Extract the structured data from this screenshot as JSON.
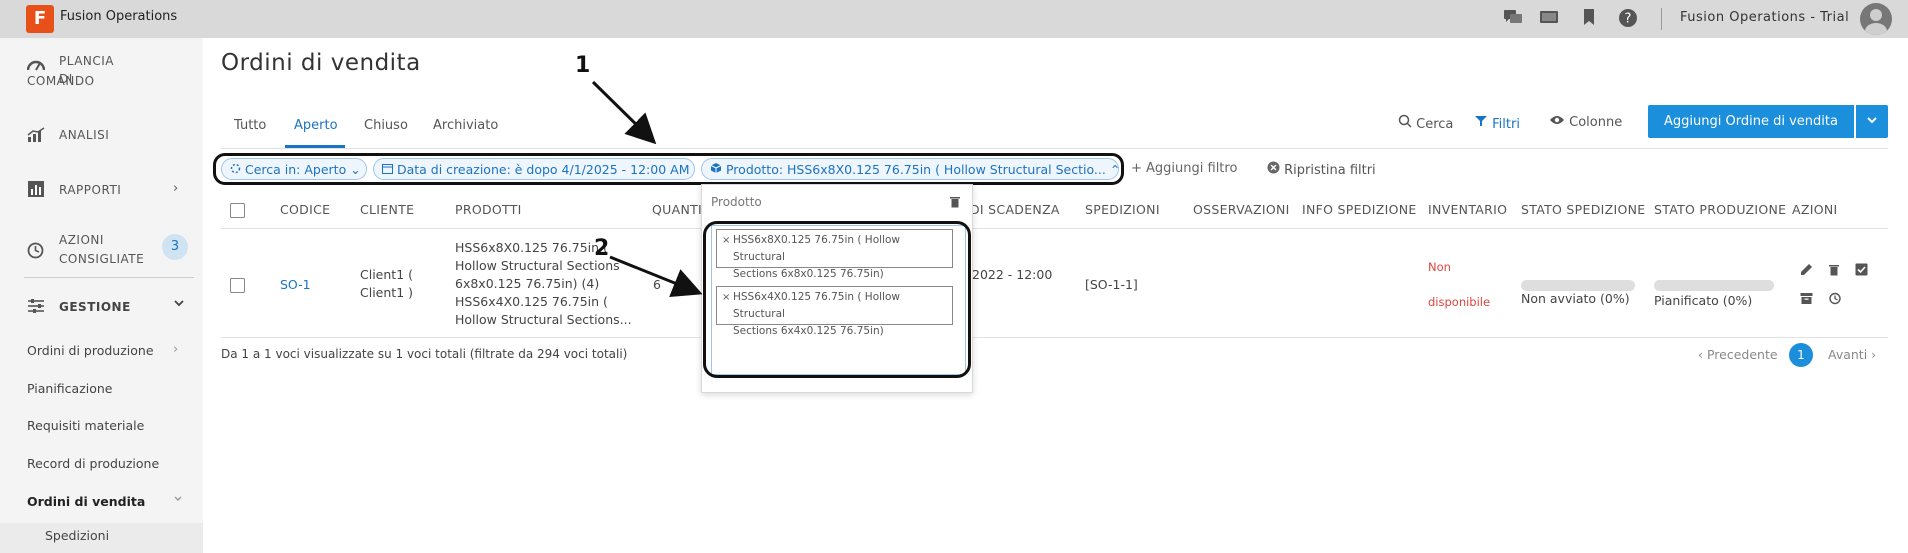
{
  "app": {
    "logo_letter": "F",
    "name": "Fusion Operations",
    "trial": "Fusion Operations - Trial"
  },
  "topbar_icons": [
    "chat-icon",
    "screen-icon",
    "bookmark-icon",
    "help-icon"
  ],
  "sidebar": {
    "dashboard_line1": "PLANCIA DI",
    "dashboard_line2": "COMANDO",
    "analysis": "ANALISI",
    "reports": "RAPPORTI",
    "suggested_line1": "AZIONI",
    "suggested_line2": "CONSIGLIATE",
    "suggested_count": "3",
    "management": "GESTIONE",
    "sub_items": [
      "Ordini di produzione",
      "Pianificazione",
      "Requisiti materiale",
      "Record di produzione",
      "Ordini di vendita",
      "Spedizioni"
    ]
  },
  "page": {
    "title": "Ordini di vendita",
    "tabs": [
      "Tutto",
      "Aperto",
      "Chiuso",
      "Archiviato"
    ],
    "active_tab": "Aperto",
    "tools": {
      "search": "Cerca",
      "filters": "Filtri",
      "columns": "Colonne"
    },
    "add_button": "Aggiungi Ordine di vendita"
  },
  "filters": {
    "chip1": "Cerca in: Aperto",
    "chip2": "Data di creazione: è dopo 4/1/2025 - 12:00 AM",
    "chip3": "Prodotto: HSS6x8X0.125 76.75in ( Hollow Structural Sectio...",
    "add": "+ Aggiungi filtro",
    "reset": "Ripristina filtri"
  },
  "table": {
    "headers": {
      "code": "CODICE",
      "client": "CLIENTE",
      "products": "PRODOTTI",
      "quantity": "QUANTI",
      "due": "DI SCADENZA",
      "shipments": "SPEDIZIONI",
      "notes": "OSSERVAZIONI",
      "ship_info": "INFO SPEDIZIONE",
      "inventory": "INVENTARIO",
      "ship_status": "STATO SPEDIZIONE",
      "prod_status": "STATO PRODUZIONE",
      "actions": "AZIONI"
    },
    "row": {
      "code": "SO-1",
      "client_line1": "Client1 (",
      "client_line2": "Client1 )",
      "product_lines": [
        "HSS6x8X0.125 76.75in (",
        "Hollow Structural Sections",
        "6x8x0.125 76.75in) (4)",
        "HSS6x4X0.125 76.75in (",
        "Hollow Structural Sections..."
      ],
      "quantity": "6",
      "due": "2022 - 12:00",
      "shipments": "[SO-1-1]",
      "inventory_line1": "Non",
      "inventory_line2": "disponibile",
      "ship_status": "Non avviato (0%)",
      "ship_progress": 0,
      "prod_status": "Pianificato (0%)",
      "prod_progress": 0
    }
  },
  "footer": {
    "info": "Da 1 a 1 voci visualizzate su 1 voci totali (filtrate da 294 voci totali)",
    "prev": "‹ Precedente",
    "page": "1",
    "next": "Avanti ›"
  },
  "popup": {
    "title": "Prodotto",
    "tags": [
      {
        "line1": "HSS6x8X0.125 76.75in ( Hollow Structural",
        "line2": "Sections 6x8x0.125 76.75in)"
      },
      {
        "line1": "HSS6x4X0.125 76.75in ( Hollow Structural",
        "line2": "Sections 6x4x0.125 76.75in)"
      }
    ]
  },
  "callouts": {
    "one": "1",
    "two": "2"
  },
  "colors": {
    "accent": "#1b8fdc",
    "link": "#1b74c3",
    "unavailable": "#e0443e",
    "logo": "#e8501a"
  }
}
